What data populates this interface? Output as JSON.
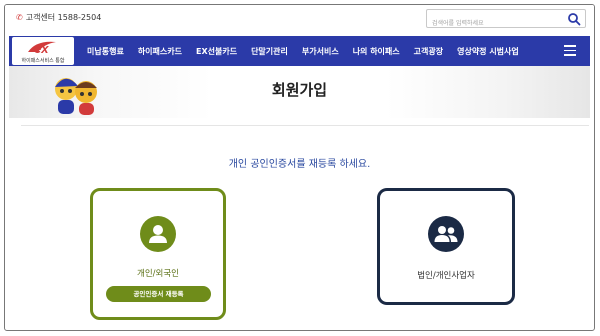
{
  "topbar": {
    "customer_center": "고객센터 1588-2504",
    "search_placeholder": "검색어를 입력하세요"
  },
  "nav": {
    "logo_caption": "하이패스서비스 통합",
    "items": [
      "미납통행료",
      "하이패스카드",
      "EX선불카드",
      "단말기관리",
      "부가서비스",
      "나의 하이패스",
      "고객광장",
      "영상약정 시범사업"
    ]
  },
  "banner": {
    "title": "회원가입"
  },
  "main": {
    "lead": "개인 공인인증서를 재등록 하세요.",
    "cards": [
      {
        "label": "개인/외국인",
        "button": "공인인증서 재등록"
      },
      {
        "label": "법인/개인사업자"
      }
    ]
  },
  "colors": {
    "nav": "#2b3aa8",
    "personal": "#6f8c1a",
    "corporate": "#1b2a45",
    "accent_red": "#d23b3b"
  }
}
